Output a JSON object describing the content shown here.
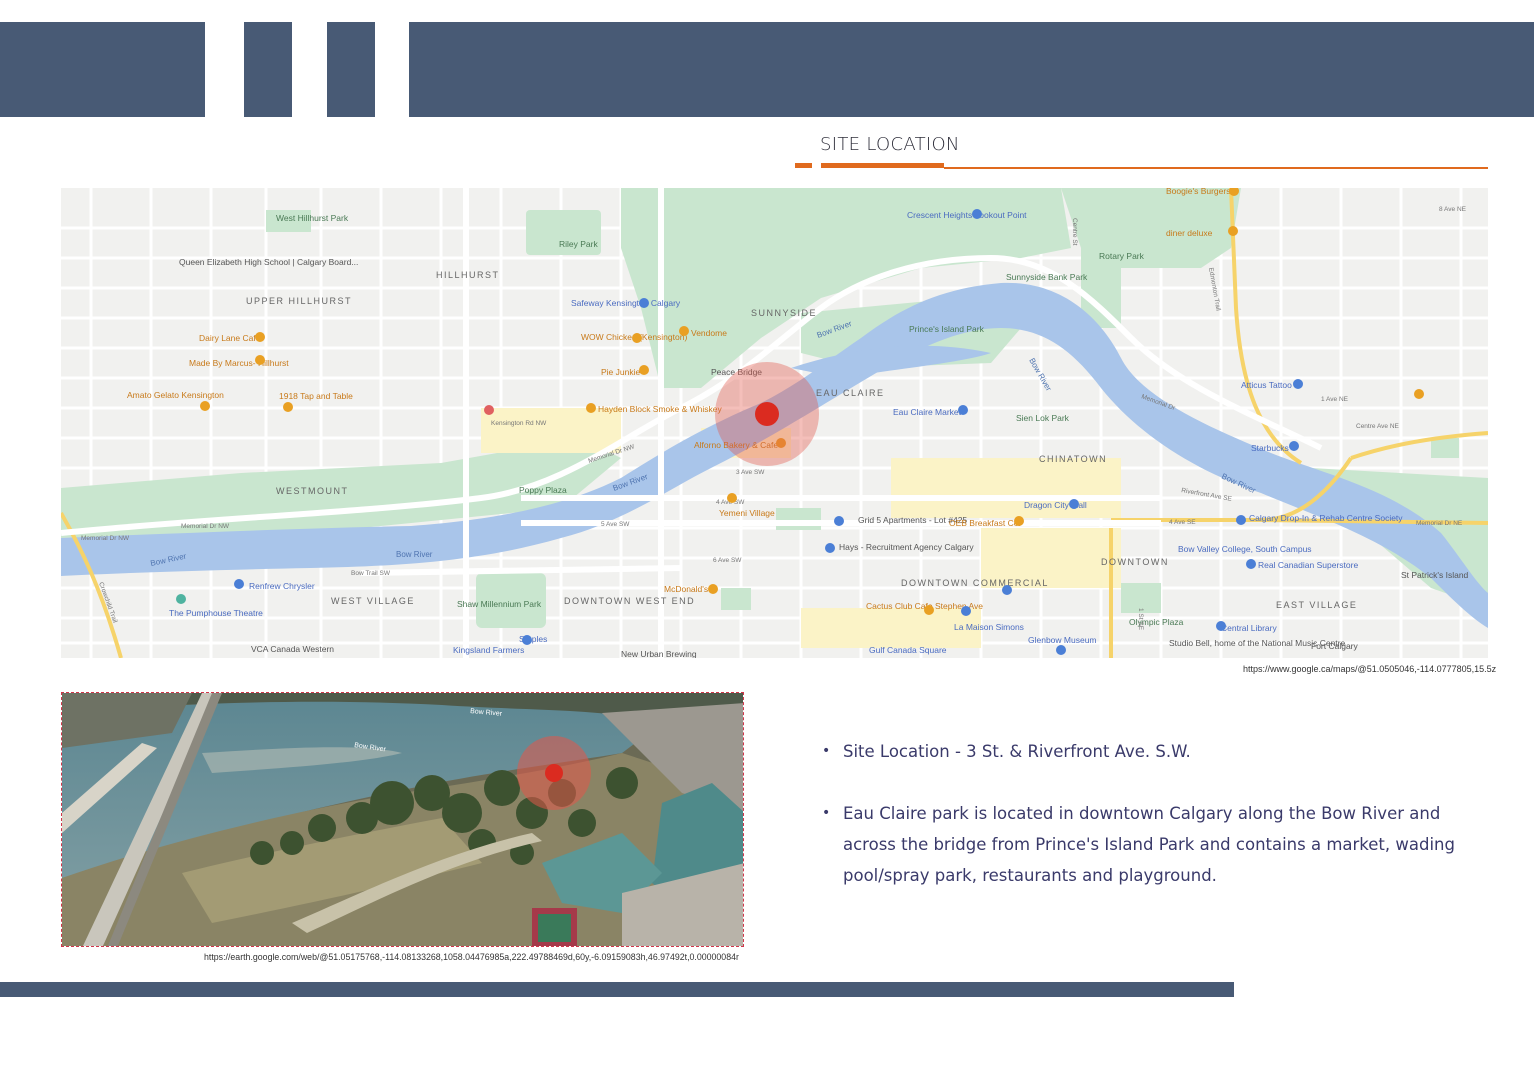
{
  "header": {
    "title": "SITE LOCATION",
    "band_color": "#485a75",
    "accent_color": "#e06a1e"
  },
  "map": {
    "neighbourhood_labels": [
      "HILLHURST",
      "UPPER HILLHURST",
      "SUNNYSIDE",
      "EAU CLAIRE",
      "CHINATOWN",
      "WESTMOUNT",
      "WEST VILLAGE",
      "DOWNTOWN WEST END",
      "DOWNTOWN COMMERCIAL",
      "DOWNTOWN",
      "EAST VILLAGE"
    ],
    "place_labels": [
      "Riley Park",
      "West Hillhurst Park",
      "Queen Elizabeth High School | Calgary Board...",
      "Safeway Kensington Calgary",
      "Vendome",
      "WOW Chicken (Kensington)",
      "Dairy Lane Cafe",
      "Made By Marcus- Hillhurst",
      "Pie Junkie",
      "Amato Gelato Kensington",
      "1918 Tap and Table",
      "Hayden Block Smoke & Whiskey",
      "Peace Bridge",
      "Alforno Bakery & Cafe",
      "Prince's Island Park",
      "Eau Claire Market",
      "Sien Lok Park",
      "Sunnyside Bank Park",
      "Rotary Park",
      "Crescent Heights Lookout Point",
      "Boogie's Burgers",
      "diner deluxe",
      "Atticus Tattoo",
      "Starbucks",
      "Poppy Plaza",
      "Yemeni Village",
      "Grid 5 Apartments - Lot #425",
      "Dragon City Mall",
      "OEB Breakfast Co.",
      "Hays - Recruitment Agency Calgary",
      "Renfrew Chrysler",
      "The Pumphouse Theatre",
      "Shaw Millennium Park",
      "McDonald's",
      "Cactus Club Cafe Stephen Ave",
      "La Maison Simons",
      "Glenbow Museum",
      "Olympic Plaza",
      "Central Library",
      "Bow Valley College, South Campus",
      "Real Canadian Superstore",
      "Calgary Drop-In & Rehab Centre Society",
      "St Patrick's Island",
      "Studio Bell, home of the National Music Centre",
      "Fort Calgary",
      "Staples",
      "Kingsland Farmers",
      "Gulf Canada Square",
      "VCA Canada Western",
      "New Urban Brewing"
    ],
    "river_labels": [
      "Bow River",
      "Bow River",
      "Bow River",
      "Bow River",
      "Bow River",
      "Bow River"
    ],
    "street_labels": [
      "Memorial Dr NW",
      "Memorial Dr NW",
      "Memorial Dr NW",
      "Bow Trail SW",
      "4 Ave SW",
      "5 Ave SW",
      "6 Ave SW",
      "4 Ave SE",
      "Memorial Dr",
      "Riverfront Ave SE",
      "Centre St",
      "1 St SE",
      "3 Ave SW",
      "Kensington Rd NW",
      "Memorial Dr NE",
      "8 Ave NE",
      "1 Ave NE",
      "Centre Ave NE",
      "Crowchild Trail",
      "Edmonton Trail"
    ],
    "credit": "https://www.google.ca/maps/@51.0505046,-114.0777805,15.5z"
  },
  "photo": {
    "river_labels": [
      "Bow River",
      "Bow River"
    ],
    "credit": "https://earth.google.com/web/@51.05175768,-114.08133268,1058.04476985a,222.49788469d,60y,-6.09159083h,46.97492t,0.00000084r"
  },
  "bullets": [
    "Site Location - 3 St. & Riverfront Ave. S.W.",
    "Eau Claire park is located in downtown Calgary along the Bow River and across the bridge from Prince's Island Park and contains a market, wading pool/spray park, restaurants and playground."
  ],
  "bullet_glyph": "•"
}
